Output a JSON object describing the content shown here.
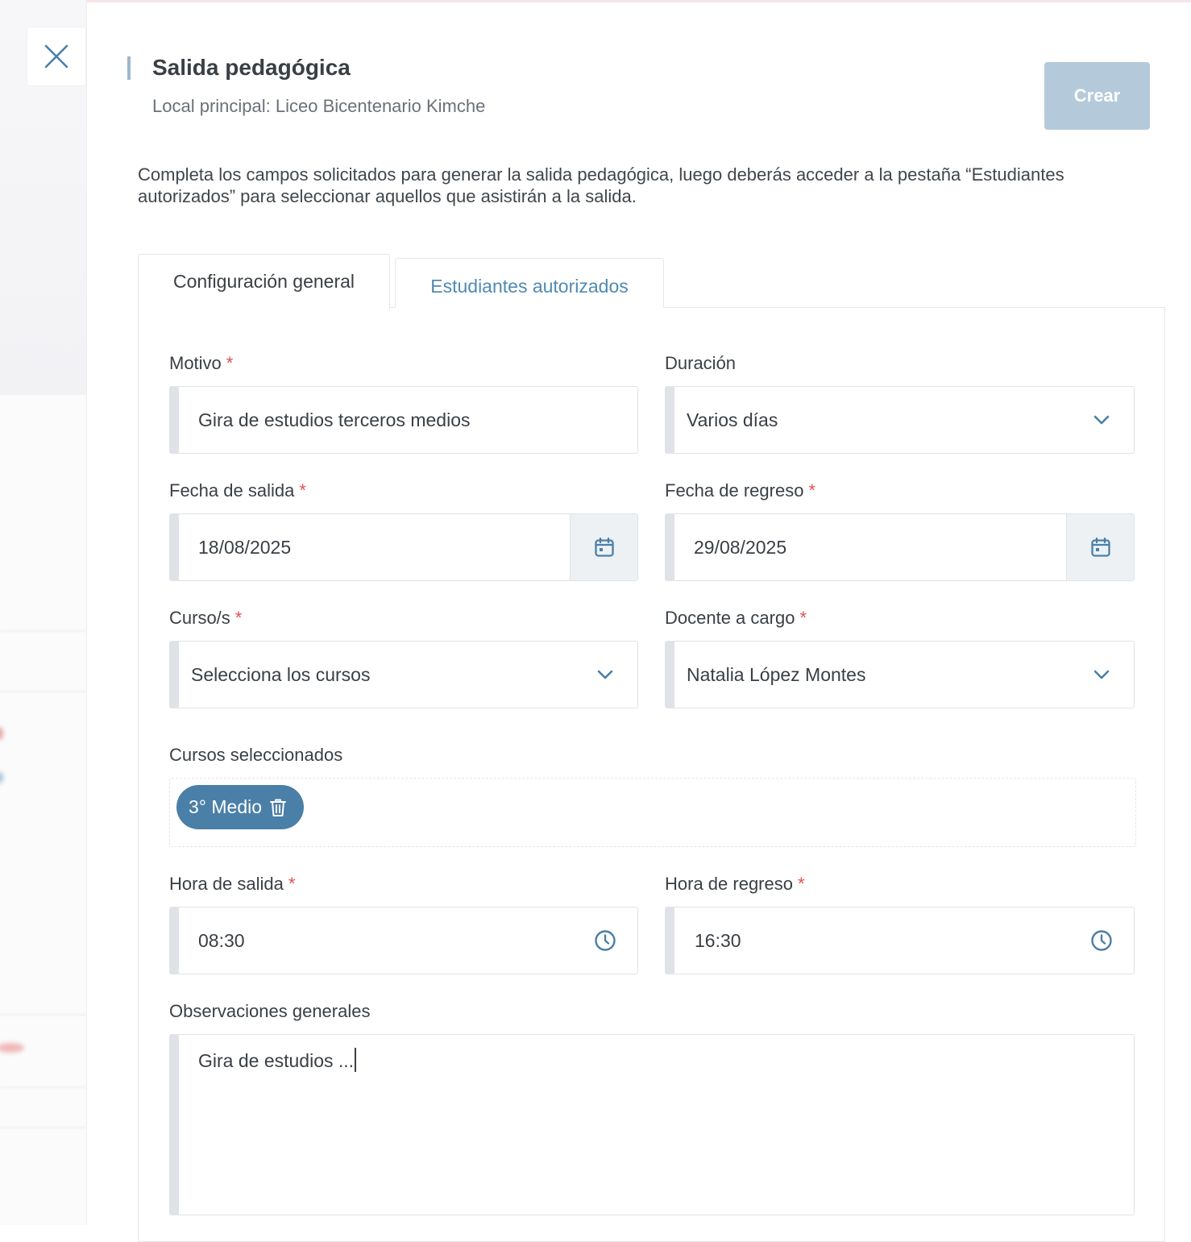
{
  "panel": {
    "title": "Salida pedagógica",
    "subtitle": "Local principal: Liceo Bicentenario Kimche",
    "create_label": "Crear",
    "description": "Completa los campos solicitados para generar la salida pedagógica, luego deberás acceder a la pestaña “Estudiantes autorizados” para seleccionar aquellos que asistirán a la salida."
  },
  "tabs": [
    {
      "label": "Configuración general",
      "active": true
    },
    {
      "label": "Estudiantes autorizados",
      "active": false
    }
  ],
  "form": {
    "motivo": {
      "label": "Motivo",
      "required": "*",
      "value": "Gira de estudios terceros medios"
    },
    "duracion": {
      "label": "Duración",
      "value": "Varios días"
    },
    "fecha_salida": {
      "label": "Fecha de salida",
      "required": "*",
      "value": "18/08/2025"
    },
    "fecha_regreso": {
      "label": "Fecha de regreso",
      "required": "*",
      "value": "29/08/2025"
    },
    "cursos": {
      "label": "Curso/s",
      "required": "*",
      "placeholder": "Selecciona los cursos"
    },
    "docente": {
      "label": "Docente a cargo",
      "required": "*",
      "value": "Natalia López Montes"
    },
    "cursos_seleccionados": {
      "label": "Cursos seleccionados",
      "chips": [
        "3° Medio"
      ]
    },
    "hora_salida": {
      "label": "Hora de salida",
      "required": "*",
      "value": "08:30"
    },
    "hora_regreso": {
      "label": "Hora de regreso",
      "required": "*",
      "value": "16:30"
    },
    "observaciones": {
      "label": "Observaciones generales",
      "value": "Gira de estudios ..."
    }
  },
  "icons": {
    "close": "close-icon",
    "chevron": "chevron-down-icon",
    "calendar": "calendar-icon",
    "clock": "clock-icon",
    "trash": "trash-icon"
  },
  "colors": {
    "accent": "#4a7fa8",
    "create_button_disabled": "#b4cadb",
    "tab_inactive_text": "#4f8ab3",
    "required": "#e0534f"
  }
}
